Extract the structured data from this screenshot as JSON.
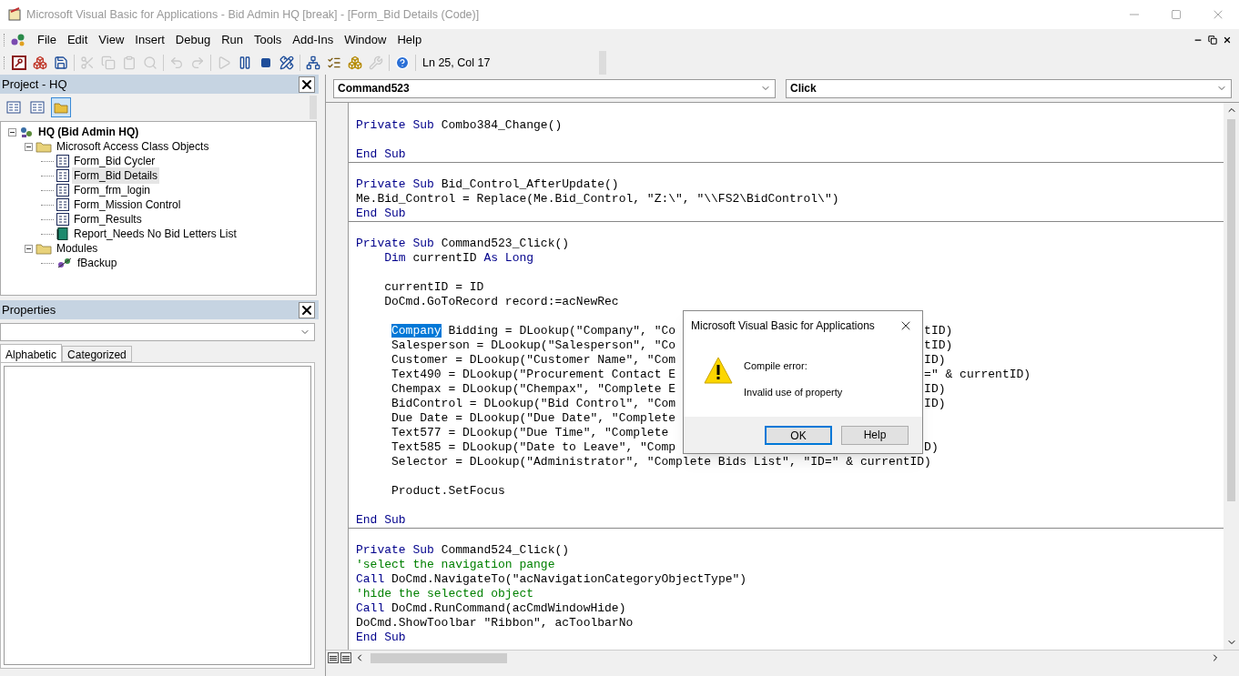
{
  "window": {
    "title": "Microsoft Visual Basic for Applications - Bid Admin HQ [break] - [Form_Bid Details (Code)]"
  },
  "menu": [
    "File",
    "Edit",
    "View",
    "Insert",
    "Debug",
    "Run",
    "Tools",
    "Add-Ins",
    "Window",
    "Help"
  ],
  "toolbar": {
    "buttons": [
      {
        "disabled": false
      },
      {
        "disabled": false
      },
      {
        "disabled": false
      },
      {
        "disabled": true
      },
      {
        "disabled": true
      },
      {
        "disabled": true
      },
      {
        "disabled": true
      },
      {
        "disabled": true
      },
      {
        "disabled": true
      },
      {
        "disabled": true
      },
      {
        "disabled": false
      },
      {
        "disabled": false
      },
      {
        "disabled": false
      },
      {
        "disabled": false
      },
      {
        "disabled": false
      },
      {
        "disabled": false
      },
      {
        "disabled": true
      },
      {
        "disabled": false
      }
    ],
    "position": "Ln 25, Col 17"
  },
  "project": {
    "title": "Project - HQ",
    "buttons": [
      {
        "selected": false
      },
      {
        "selected": false
      },
      {
        "selected": true
      }
    ],
    "tree": [
      {
        "kind": "project",
        "label": "HQ (Bid Admin HQ)",
        "expanded": true,
        "selected": false,
        "children": [
          {
            "kind": "folder",
            "label": "Microsoft Access Class Objects",
            "expanded": true,
            "selected": false,
            "children": [
              {
                "kind": "form",
                "label": "Form_Bid Cycler",
                "selected": false
              },
              {
                "kind": "form",
                "label": "Form_Bid Details",
                "selected": true
              },
              {
                "kind": "form",
                "label": "Form_frm_login",
                "selected": false
              },
              {
                "kind": "form",
                "label": "Form_Mission Control",
                "selected": false
              },
              {
                "kind": "form",
                "label": "Form_Results",
                "selected": false
              },
              {
                "kind": "report",
                "label": "Report_Needs No Bid Letters List",
                "selected": false
              }
            ]
          },
          {
            "kind": "folder",
            "label": "Modules",
            "expanded": true,
            "selected": false,
            "children": [
              {
                "kind": "module",
                "label": "fBackup",
                "selected": false
              }
            ]
          }
        ]
      }
    ]
  },
  "properties": {
    "title": "Properties",
    "tabs": [
      {
        "label": "Alphabetic",
        "selected": true
      },
      {
        "label": "Categorized",
        "selected": false
      }
    ]
  },
  "code_window": {
    "object": "Command523",
    "procedure": "Click",
    "procedures": [
      {
        "lines": [
          {
            "kind": "code",
            "parts": [
              {
                "kind": "keyword",
                "text": "Private Sub"
              },
              {
                "kind": "plain",
                "text": " Combo384_Change()"
              }
            ]
          },
          {
            "kind": "blank"
          },
          {
            "kind": "code",
            "parts": [
              {
                "kind": "keyword",
                "text": "End Sub"
              }
            ]
          }
        ]
      },
      {
        "lines": [
          {
            "kind": "blank"
          },
          {
            "kind": "code",
            "parts": [
              {
                "kind": "keyword",
                "text": "Private Sub"
              },
              {
                "kind": "plain",
                "text": " Bid_Control_AfterUpdate()"
              }
            ]
          },
          {
            "kind": "code",
            "parts": [
              {
                "kind": "plain",
                "text": "Me.Bid_Control = Replace(Me.Bid_Control, \"Z:\\\", \"\\\\FS2\\BidControl\\\")"
              }
            ]
          },
          {
            "kind": "code",
            "parts": [
              {
                "kind": "keyword",
                "text": "End Sub"
              }
            ]
          }
        ]
      },
      {
        "lines": [
          {
            "kind": "blank"
          },
          {
            "kind": "code",
            "parts": [
              {
                "kind": "keyword",
                "text": "Private Sub"
              },
              {
                "kind": "plain",
                "text": " Command523_Click()"
              }
            ]
          },
          {
            "kind": "code",
            "parts": [
              {
                "kind": "keyword",
                "text": "    Dim"
              },
              {
                "kind": "plain",
                "text": " currentID "
              },
              {
                "kind": "keyword",
                "text": "As Long"
              }
            ]
          },
          {
            "kind": "blank"
          },
          {
            "kind": "code",
            "parts": [
              {
                "kind": "plain",
                "text": "    currentID = ID"
              }
            ]
          },
          {
            "kind": "code",
            "parts": [
              {
                "kind": "plain",
                "text": "    DoCmd.GoToRecord record:=acNewRec"
              }
            ]
          },
          {
            "kind": "blank"
          },
          {
            "kind": "code",
            "parts": [
              {
                "kind": "selected",
                "text": "     Company"
              },
              {
                "kind": "plain",
                "text": " Bidding = DLookup(\"Company\", \"Co"
              }
            ],
            "tail": "tID)"
          },
          {
            "kind": "code",
            "parts": [
              {
                "kind": "plain",
                "text": "     Salesperson = DLookup(\"Salesperson\", \"Co"
              }
            ],
            "tail": "tID)"
          },
          {
            "kind": "code",
            "parts": [
              {
                "kind": "plain",
                "text": "     Customer = DLookup(\"Customer Name\", \"Com"
              }
            ],
            "tail": "ID)"
          },
          {
            "kind": "code",
            "parts": [
              {
                "kind": "plain",
                "text": "     Text490 = DLookup(\"Procurement Contact E"
              }
            ],
            "tail": "=\" & currentID)"
          },
          {
            "kind": "code",
            "parts": [
              {
                "kind": "plain",
                "text": "     Chempax = DLookup(\"Chempax\", \"Complete E"
              }
            ],
            "tail": "ID)"
          },
          {
            "kind": "code",
            "parts": [
              {
                "kind": "plain",
                "text": "     BidControl = DLookup(\"Bid Control\", \"Com"
              }
            ],
            "tail": "ID)"
          },
          {
            "kind": "code",
            "parts": [
              {
                "kind": "plain",
                "text": "     Due Date = DLookup(\"Due Date\", \"Complete"
              }
            ]
          },
          {
            "kind": "code",
            "parts": [
              {
                "kind": "plain",
                "text": "     Text577 = DLookup(\"Due Time\", \"Complete"
              }
            ]
          },
          {
            "kind": "code",
            "parts": [
              {
                "kind": "plain",
                "text": "     Text585 = DLookup(\"Date to Leave\", \"Comp"
              }
            ],
            "tail": "D)"
          },
          {
            "kind": "code",
            "parts": [
              {
                "kind": "plain",
                "text": "     Selector = DLookup(\"Administrator\", \"Complete Bids List\", \"ID=\" & currentID)"
              }
            ]
          },
          {
            "kind": "blank"
          },
          {
            "kind": "code",
            "parts": [
              {
                "kind": "plain",
                "text": "     Product.SetFocus"
              }
            ]
          },
          {
            "kind": "blank"
          },
          {
            "kind": "code",
            "parts": [
              {
                "kind": "keyword",
                "text": "End Sub"
              }
            ]
          }
        ]
      },
      {
        "lines": [
          {
            "kind": "blank"
          },
          {
            "kind": "code",
            "parts": [
              {
                "kind": "keyword",
                "text": "Private Sub"
              },
              {
                "kind": "plain",
                "text": " Command524_Click()"
              }
            ]
          },
          {
            "kind": "code",
            "parts": [
              {
                "kind": "comment",
                "text": "'select the navigation pange"
              }
            ]
          },
          {
            "kind": "code",
            "parts": [
              {
                "kind": "keyword",
                "text": "Call"
              },
              {
                "kind": "plain",
                "text": " DoCmd.NavigateTo(\"acNavigationCategoryObjectType\")"
              }
            ]
          },
          {
            "kind": "code",
            "parts": [
              {
                "kind": "comment",
                "text": "'hide the selected object"
              }
            ]
          },
          {
            "kind": "code",
            "parts": [
              {
                "kind": "keyword",
                "text": "Call"
              },
              {
                "kind": "plain",
                "text": " DoCmd.RunCommand(acCmdWindowHide)"
              }
            ]
          },
          {
            "kind": "code",
            "parts": [
              {
                "kind": "plain",
                "text": "DoCmd.ShowToolbar \"Ribbon\", acToolbarNo"
              }
            ]
          },
          {
            "kind": "code",
            "parts": [
              {
                "kind": "keyword",
                "text": "End Sub"
              }
            ]
          }
        ]
      }
    ]
  },
  "dialog": {
    "title": "Microsoft Visual Basic for Applications",
    "heading": "Compile error:",
    "message": "Invalid use of property",
    "buttons": [
      {
        "label": "OK",
        "selected": true
      },
      {
        "label": "Help",
        "selected": false
      }
    ]
  }
}
